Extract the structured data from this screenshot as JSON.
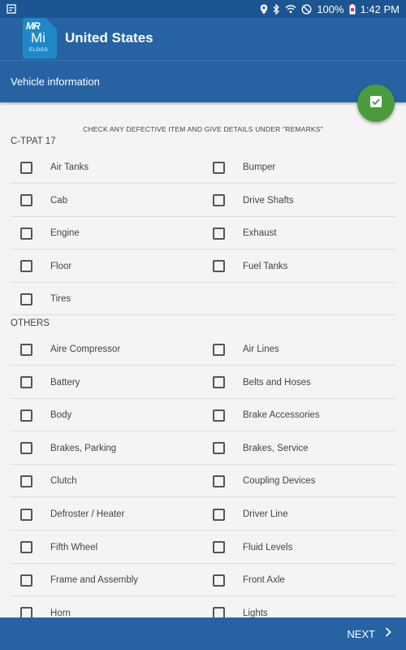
{
  "status_bar": {
    "battery": "100%",
    "time": "1:42 PM"
  },
  "app": {
    "logo_text": {
      "mark": "MR",
      "mi": "Mi",
      "elogs": "ELOGS"
    },
    "title": "United States"
  },
  "sub_header": {
    "title": "Vehicle information"
  },
  "instruction": "CHECK ANY DEFECTIVE ITEM AND GIVE DETAILS UNDER \"REMARKS\"",
  "sections": [
    {
      "title": "C-TPAT 17",
      "rows": [
        [
          "Air Tanks",
          "Bumper"
        ],
        [
          "Cab",
          "Drive Shafts"
        ],
        [
          "Engine",
          "Exhaust"
        ],
        [
          "Floor",
          "Fuel Tanks"
        ],
        [
          "Tires",
          null
        ]
      ]
    },
    {
      "title": "OTHERS",
      "rows": [
        [
          "Aire Compressor",
          "Air Lines"
        ],
        [
          "Battery",
          "Belts and Hoses"
        ],
        [
          "Body",
          "Brake Accessories"
        ],
        [
          "Brakes, Parking",
          "Brakes, Service"
        ],
        [
          "Clutch",
          "Coupling Devices"
        ],
        [
          "Defroster / Heater",
          "Driver Line"
        ],
        [
          "Fifth Wheel",
          "Fluid Levels"
        ],
        [
          "Frame and Assembly",
          "Front Axle"
        ],
        [
          "Horn",
          "Lights"
        ]
      ]
    }
  ],
  "footer": {
    "next_label": "NEXT"
  },
  "colors": {
    "primary": "#2763a3",
    "status_bar": "#1d5592",
    "fab": "#4c9b3c",
    "background": "#f4f4f4"
  }
}
